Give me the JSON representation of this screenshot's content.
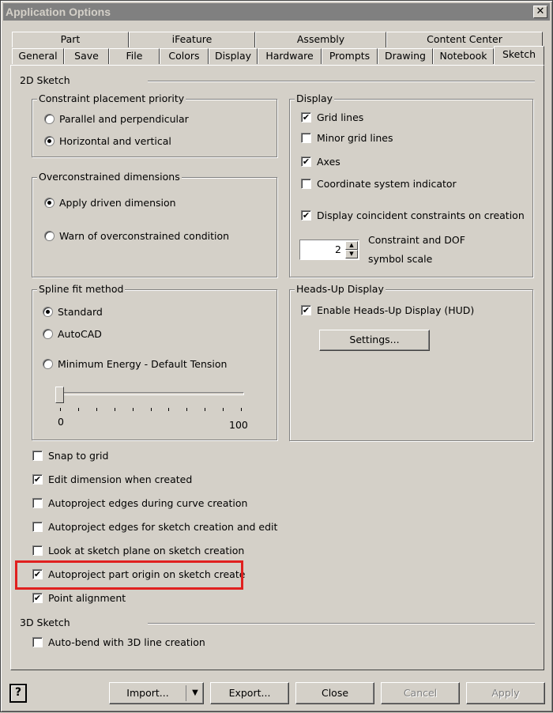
{
  "window": {
    "title": "Application Options",
    "close_glyph": "✕"
  },
  "tabs_row1": [
    {
      "label": "Part"
    },
    {
      "label": "iFeature"
    },
    {
      "label": "Assembly"
    },
    {
      "label": "Content Center"
    }
  ],
  "tabs_row2": [
    {
      "label": "General"
    },
    {
      "label": "Save"
    },
    {
      "label": "File"
    },
    {
      "label": "Colors"
    },
    {
      "label": "Display"
    },
    {
      "label": "Hardware"
    },
    {
      "label": "Prompts"
    },
    {
      "label": "Drawing"
    },
    {
      "label": "Notebook"
    },
    {
      "label": "Sketch"
    }
  ],
  "sketch2d": {
    "heading": "2D Sketch",
    "constraint_priority": {
      "title": "Constraint placement priority",
      "opt1": "Parallel and perpendicular",
      "opt2": "Horizontal and vertical",
      "selected": "Horizontal and vertical"
    },
    "overconstrained": {
      "title": "Overconstrained dimensions",
      "opt1": "Apply driven dimension",
      "opt2": "Warn of overconstrained condition",
      "selected": "Apply driven dimension"
    },
    "spline": {
      "title": "Spline fit method",
      "opt1": "Standard",
      "opt2": "AutoCAD",
      "opt3": "Minimum Energy - Default Tension",
      "selected": "Standard",
      "slider_min": "0",
      "slider_max": "100",
      "slider_value": 0
    },
    "display": {
      "title": "Display",
      "grid_lines": "Grid lines",
      "minor_grid_lines": "Minor grid lines",
      "axes": "Axes",
      "coord_indicator": "Coordinate system indicator",
      "coincident": "Display coincident constraints on creation",
      "dof_label_1": "Constraint and DOF",
      "dof_label_2": "symbol scale",
      "dof_value": "2"
    },
    "hud": {
      "title": "Heads-Up Display",
      "enable": "Enable Heads-Up Display (HUD)",
      "settings_button": "Settings..."
    },
    "options": {
      "snap": "Snap to grid",
      "edit_dim": "Edit dimension when created",
      "autoproject_curve": "Autoproject edges during curve creation",
      "autoproject_sketch": "Autoproject edges for sketch creation and edit",
      "look_at": "Look at sketch plane on sketch creation",
      "autoproject_origin": "Autoproject part origin on sketch create",
      "point_alignment": "Point alignment"
    }
  },
  "sketch3d": {
    "heading": "3D Sketch",
    "autobend": "Auto-bend with 3D line creation"
  },
  "footer": {
    "help": "?",
    "import": "Import...",
    "import_arrow": "▼",
    "export": "Export...",
    "close": "Close",
    "cancel": "Cancel",
    "apply": "Apply"
  },
  "check_glyph": "✔",
  "colors": {
    "highlight": "#e0201f",
    "title_bar": "#808080"
  }
}
